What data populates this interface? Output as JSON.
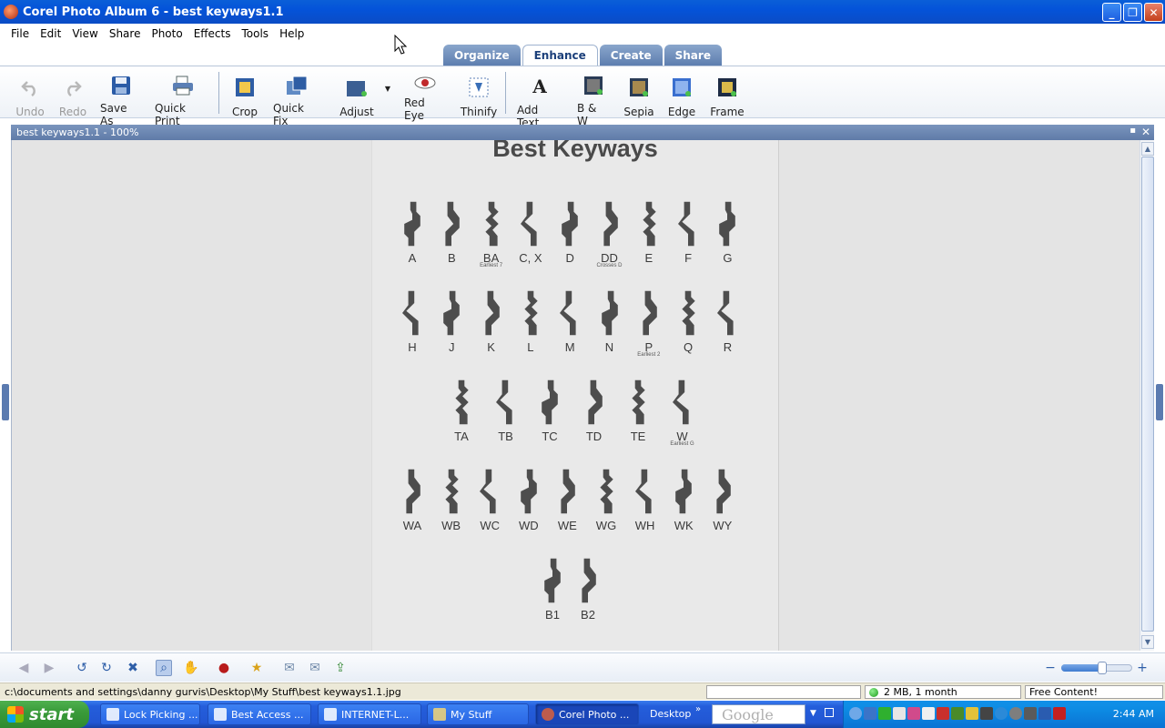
{
  "window": {
    "title": "Corel Photo Album 6 - best keyways1.1"
  },
  "menu": [
    "File",
    "Edit",
    "View",
    "Share",
    "Photo",
    "Effects",
    "Tools",
    "Help"
  ],
  "tabs": [
    {
      "label": "Organize",
      "active": false
    },
    {
      "label": "Enhance",
      "active": true
    },
    {
      "label": "Create",
      "active": false
    },
    {
      "label": "Share",
      "active": false
    }
  ],
  "toolbar": {
    "undo": "Undo",
    "redo": "Redo",
    "save_as": "Save As",
    "quick_print": "Quick Print",
    "crop": "Crop",
    "quick_fix": "Quick Fix",
    "adjust": "Adjust",
    "red_eye": "Red Eye",
    "thinify": "Thinify",
    "add_text": "Add Text",
    "bw": "B & W",
    "sepia": "Sepia",
    "edge": "Edge",
    "frame": "Frame"
  },
  "document": {
    "tab_title": "best keyways1.1 - 100%"
  },
  "photo": {
    "title": "Best Keyways",
    "rows": [
      [
        {
          "l": "A"
        },
        {
          "l": "B"
        },
        {
          "l": "BA",
          "s": "Earliest 7"
        },
        {
          "l": "C, X"
        },
        {
          "l": "D"
        },
        {
          "l": "DD",
          "s": "Crosses D"
        },
        {
          "l": "E"
        },
        {
          "l": "F"
        },
        {
          "l": "G"
        }
      ],
      [
        {
          "l": "H"
        },
        {
          "l": "J"
        },
        {
          "l": "K"
        },
        {
          "l": "L"
        },
        {
          "l": "M"
        },
        {
          "l": "N"
        },
        {
          "l": "P",
          "s": "Earliest 2"
        },
        {
          "l": "Q"
        },
        {
          "l": "R"
        }
      ],
      [
        {
          "l": "TA"
        },
        {
          "l": "TB"
        },
        {
          "l": "TC"
        },
        {
          "l": "TD"
        },
        {
          "l": "TE"
        },
        {
          "l": "W",
          "s": "Earliest G"
        }
      ],
      [
        {
          "l": "WA"
        },
        {
          "l": "WB"
        },
        {
          "l": "WC"
        },
        {
          "l": "WD"
        },
        {
          "l": "WE"
        },
        {
          "l": "WG"
        },
        {
          "l": "WH"
        },
        {
          "l": "WK"
        },
        {
          "l": "WY"
        }
      ],
      [
        {
          "l": "B1"
        },
        {
          "l": "B2"
        }
      ]
    ]
  },
  "status": {
    "path": "c:\\documents and settings\\danny gurvis\\Desktop\\My Stuff\\best keyways1.1.jpg",
    "usage": "2 MB, 1 month",
    "free_content": "Free Content!"
  },
  "taskbar": {
    "start": "start",
    "items": [
      {
        "label": "Lock Picking ...",
        "active": false
      },
      {
        "label": "Best Access ...",
        "active": false
      },
      {
        "label": "INTERNET-L...",
        "active": false
      },
      {
        "label": "My Stuff",
        "active": false
      },
      {
        "label": "Corel Photo ...",
        "active": true
      }
    ],
    "desktop": "Desktop",
    "search_placeholder": "Google",
    "clock": "2:44 AM"
  },
  "colors": {
    "titlebar": "#0453d9",
    "taskbar": "#245edb",
    "start": "#3a9b3a",
    "tab_inactive": "#6f8fbf"
  }
}
